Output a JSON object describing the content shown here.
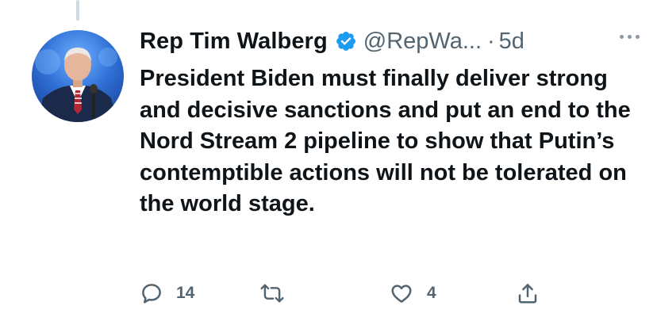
{
  "tweet": {
    "author_name": "Rep Tim Walberg",
    "handle": "@RepWa...",
    "separator": "·",
    "timestamp": "5d",
    "text": "President Biden must finally deliver strong and decisive sanctions and put an end to the Nord Stream 2 pipeline to show that Putin’s contemptible actions will not be tolerated on the world stage.",
    "verified": true
  },
  "actions": {
    "reply_count": "14",
    "retweet_count": "",
    "like_count": "4"
  },
  "icons": {
    "verified": "verified-badge-icon",
    "more": "more-options-icon",
    "reply": "reply-icon",
    "retweet": "retweet-icon",
    "like": "like-icon",
    "share": "share-icon"
  },
  "colors": {
    "verified": "#1d9bf0",
    "text": "#0f1419",
    "muted": "#536471",
    "thread_line": "#cfd9de"
  }
}
